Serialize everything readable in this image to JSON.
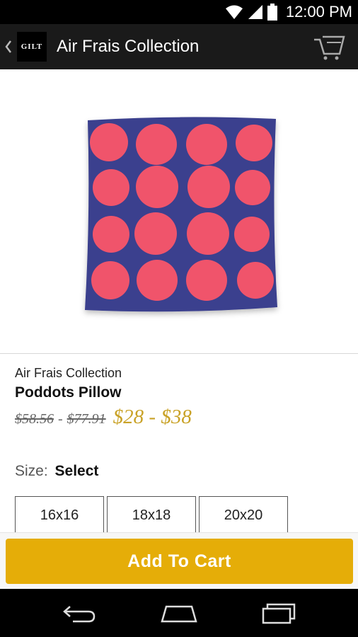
{
  "status_bar": {
    "time": "12:00 PM"
  },
  "app_bar": {
    "logo_text": "GILT",
    "title": "Air Frais Collection"
  },
  "product": {
    "brand": "Air Frais Collection",
    "name": "Poddots Pillow",
    "original_price_low": "$58.56",
    "price_separator": "-",
    "original_price_high": "$77.91",
    "sale_price": "$28 - $38"
  },
  "size": {
    "label": "Size:",
    "value": "Select",
    "options": [
      "16x16",
      "18x18",
      "20x20"
    ]
  },
  "actions": {
    "add_to_cart_label": "Add To Cart"
  },
  "colors": {
    "accent": "#e5ad08",
    "sale_price": "#c9a227",
    "pillow_blue": "#3a3f8e",
    "pillow_dots": "#f0546b"
  }
}
